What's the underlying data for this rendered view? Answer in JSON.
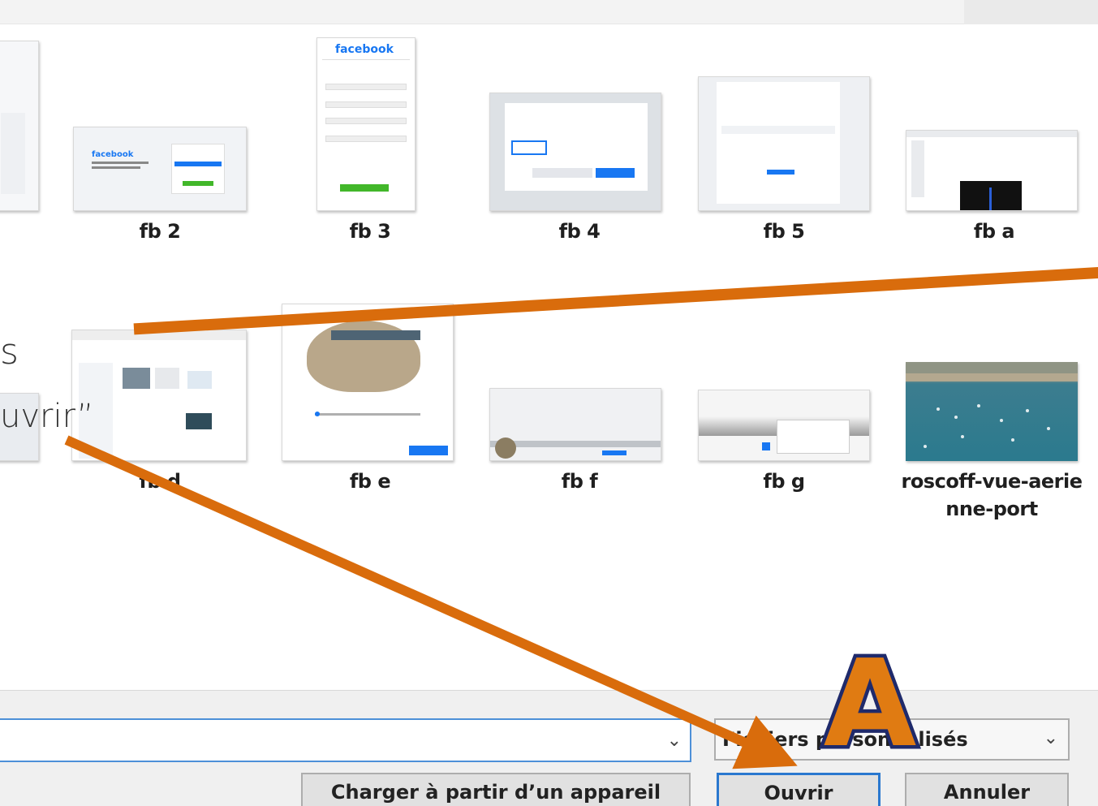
{
  "files_row1": [
    {
      "label": "fb 2"
    },
    {
      "label": "fb 3"
    },
    {
      "label": "fb 4"
    },
    {
      "label": "fb 5"
    },
    {
      "label": "fb a"
    }
  ],
  "files_row2": [
    {
      "label": "fb d"
    },
    {
      "label": "fb e"
    },
    {
      "label": "fb f"
    },
    {
      "label": "fb g"
    },
    {
      "label_line1": "roscoff-vue-aerie",
      "label_line2": "nne-port"
    }
  ],
  "thumb_text": {
    "fb3_brand": "facebook",
    "fb2_brand": "facebook"
  },
  "side_text": {
    "line1": "s",
    "line2": "uvrir”"
  },
  "bottom": {
    "filetype_value": "Fichiers personnalisés",
    "mobile_button": "Charger à partir d’un appareil mobile",
    "open_button": "Ouvrir",
    "cancel_button": "Annuler"
  },
  "annotation": {
    "badge_letter": "A",
    "arrow_color": "#d96c0c",
    "badge_fill": "#e07b12",
    "badge_stroke": "#1f2a6b"
  }
}
